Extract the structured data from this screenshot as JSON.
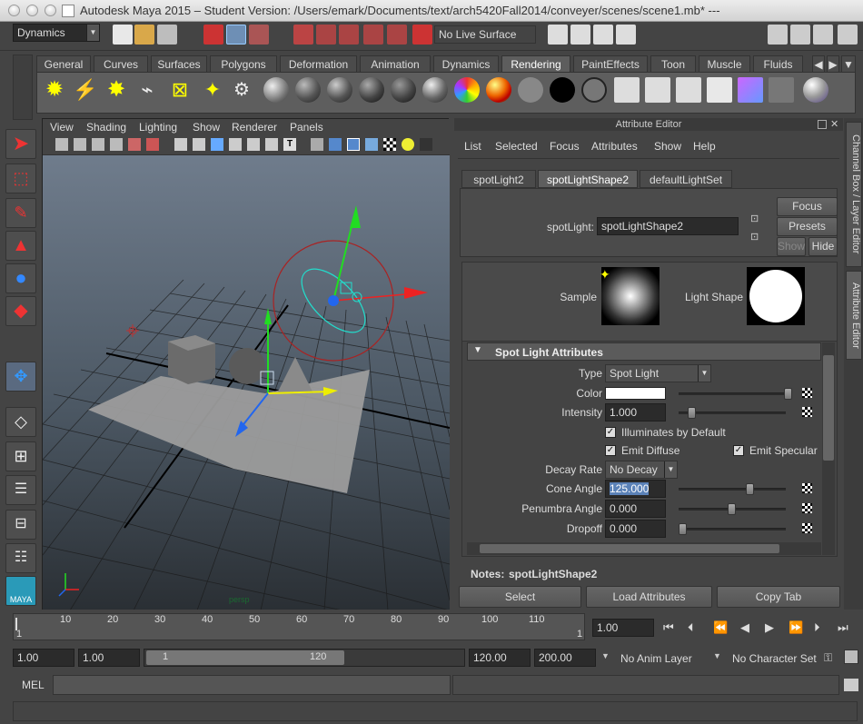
{
  "window": {
    "title": "Autodesk Maya 2015 – Student Version: /Users/emark/Documents/text/arch5420Fall2014/conveyer/scenes/scene1.mb*   ---"
  },
  "topbar": {
    "menu_set": "Dynamics",
    "live_surface": "No Live Surface"
  },
  "shelf": {
    "tabs": [
      "General",
      "Curves",
      "Surfaces",
      "Polygons",
      "Deformation",
      "Animation",
      "Dynamics",
      "Rendering",
      "PaintEffects",
      "Toon",
      "Muscle",
      "Fluids"
    ],
    "active_tab": "Rendering"
  },
  "viewport": {
    "menu": [
      "View",
      "Shading",
      "Lighting",
      "Show",
      "Renderer",
      "Panels"
    ],
    "camera_label": "persp"
  },
  "attribute_editor": {
    "header": "Attribute Editor",
    "menu": [
      "List",
      "Selected",
      "Focus",
      "Attributes",
      "Show",
      "Help"
    ],
    "tabs": [
      "spotLight2",
      "spotLightShape2",
      "defaultLightSet"
    ],
    "active_tab": "spotLightShape2",
    "node_type_label": "spotLight:",
    "node_name": "spotLightShape2",
    "focus_label": "Focus",
    "presets_label": "Presets",
    "show_label": "Show",
    "hide_label": "Hide",
    "sample_label": "Sample",
    "light_shape_label": "Light Shape",
    "section_title": "Spot Light Attributes",
    "type_label": "Type",
    "type_value": "Spot Light",
    "color_label": "Color",
    "intensity_label": "Intensity",
    "intensity_value": "1.000",
    "illuminates_label": "Illuminates by Default",
    "emit_diffuse_label": "Emit Diffuse",
    "emit_specular_label": "Emit Specular",
    "decay_label": "Decay Rate",
    "decay_value": "No Decay",
    "cone_label": "Cone Angle",
    "cone_value": "125.000",
    "penumbra_label": "Penumbra Angle",
    "penumbra_value": "0.000",
    "dropoff_label": "Dropoff",
    "dropoff_value": "0.000",
    "notes_label": "Notes:",
    "notes_value": "spotLightShape2",
    "select_label": "Select",
    "load_label": "Load Attributes",
    "copy_label": "Copy Tab"
  },
  "side_tabs": {
    "channel_box": "Channel Box / Layer Editor",
    "attribute_editor": "Attribute Editor"
  },
  "timeline": {
    "ticks": [
      "1",
      "10",
      "20",
      "30",
      "40",
      "50",
      "60",
      "70",
      "80",
      "90",
      "100",
      "110",
      "1"
    ],
    "current_frame": "1.00"
  },
  "range": {
    "start": "1.00",
    "playback_start": "1.00",
    "range_min": "1",
    "range_max": "120",
    "playback_end": "120.00",
    "end": "200.00",
    "anim_layer": "No Anim Layer",
    "character_set": "No Character Set"
  },
  "command": {
    "mode": "MEL"
  },
  "colors": {
    "accent_blue": "#5b82b8",
    "x_axis": "#dd2222",
    "y_axis": "#22cc22",
    "z_axis": "#2244ee"
  }
}
